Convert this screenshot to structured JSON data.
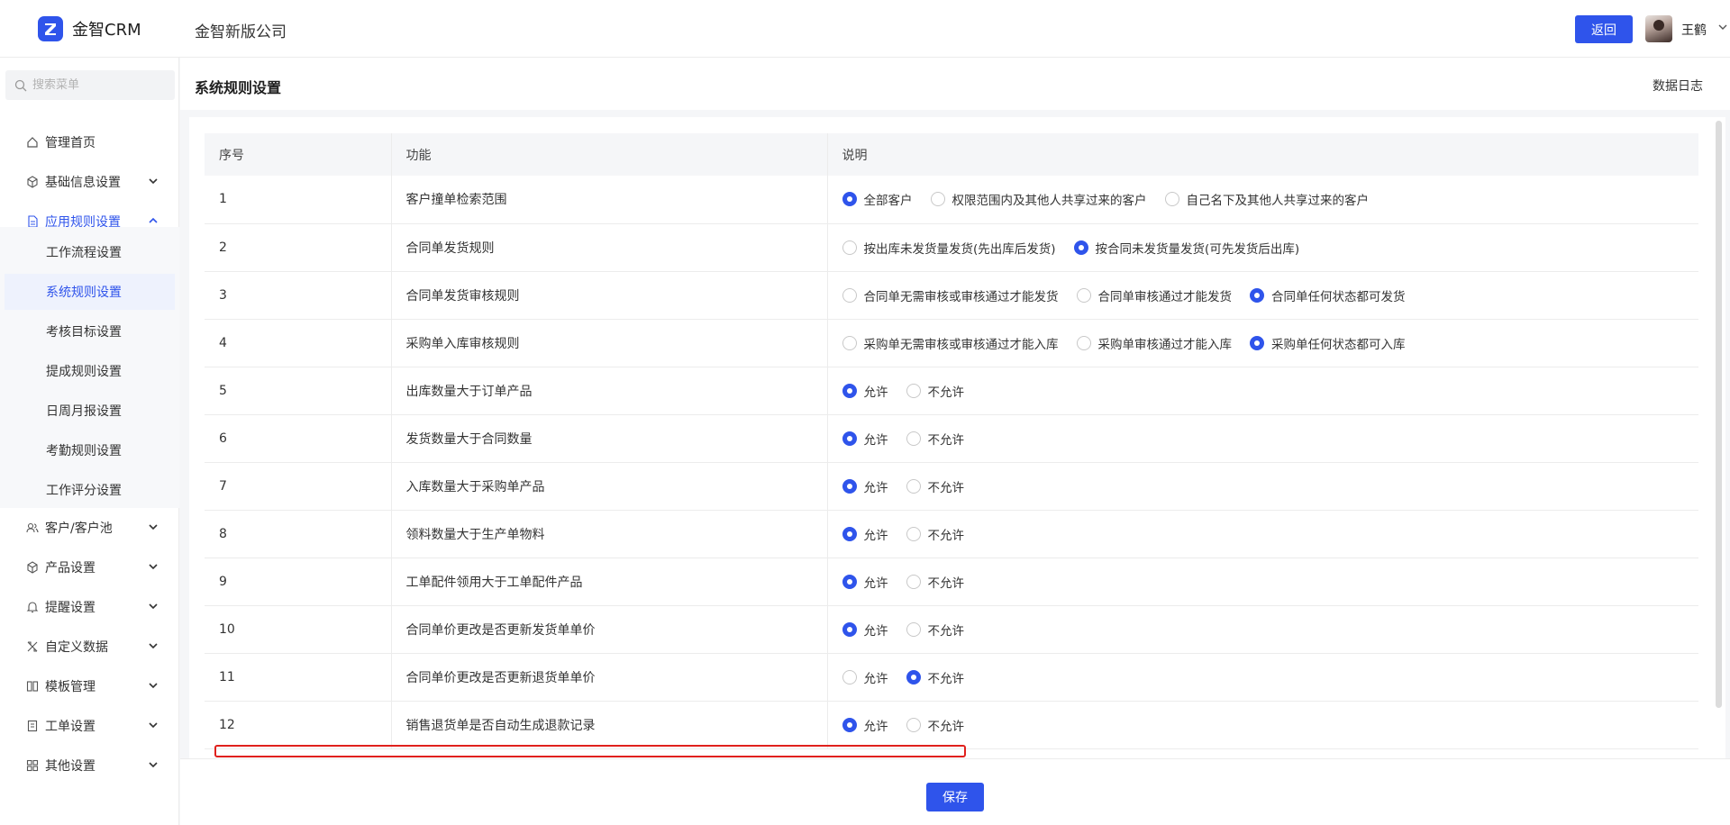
{
  "header": {
    "brand": "金智CRM",
    "company": "金智新版公司",
    "back_label": "返回",
    "user_name": "王鹤"
  },
  "sidebar": {
    "search_placeholder": "搜索菜单",
    "items": [
      {
        "label": "管理首页",
        "icon": "home-icon"
      },
      {
        "label": "基础信息设置",
        "icon": "cube-icon"
      },
      {
        "label": "应用规则设置",
        "icon": "document-icon"
      },
      {
        "label": "客户/客户池",
        "icon": "users-icon"
      },
      {
        "label": "产品设置",
        "icon": "box-icon"
      },
      {
        "label": "提醒设置",
        "icon": "bell-icon"
      },
      {
        "label": "自定义数据",
        "icon": "tools-icon"
      },
      {
        "label": "模板管理",
        "icon": "template-icon"
      },
      {
        "label": "工单设置",
        "icon": "workorder-icon"
      },
      {
        "label": "其他设置",
        "icon": "grid-icon"
      }
    ],
    "subitems": [
      "工作流程设置",
      "系统规则设置",
      "考核目标设置",
      "提成规则设置",
      "日周月报设置",
      "考勤规则设置",
      "工作评分设置"
    ]
  },
  "page": {
    "title": "系统规则设置",
    "data_log": "数据日志",
    "save_label": "保存"
  },
  "table": {
    "headers": [
      "序号",
      "功能",
      "说明"
    ],
    "rows": [
      {
        "no": "1",
        "feature": "客户撞单检索范围",
        "options": [
          "全部客户",
          "权限范围内及其他人共享过来的客户",
          "自己名下及其他人共享过来的客户"
        ],
        "selected": 0
      },
      {
        "no": "2",
        "feature": "合同单发货规则",
        "options": [
          "按出库未发货量发货(先出库后发货)",
          "按合同未发货量发货(可先发货后出库)"
        ],
        "selected": 1
      },
      {
        "no": "3",
        "feature": "合同单发货审核规则",
        "options": [
          "合同单无需审核或审核通过才能发货",
          "合同单审核通过才能发货",
          "合同单任何状态都可发货"
        ],
        "selected": 2
      },
      {
        "no": "4",
        "feature": "采购单入库审核规则",
        "options": [
          "采购单无需审核或审核通过才能入库",
          "采购单审核通过才能入库",
          "采购单任何状态都可入库"
        ],
        "selected": 2
      },
      {
        "no": "5",
        "feature": "出库数量大于订单产品",
        "options": [
          "允许",
          "不允许"
        ],
        "selected": 0
      },
      {
        "no": "6",
        "feature": "发货数量大于合同数量",
        "options": [
          "允许",
          "不允许"
        ],
        "selected": 0
      },
      {
        "no": "7",
        "feature": "入库数量大于采购单产品",
        "options": [
          "允许",
          "不允许"
        ],
        "selected": 0
      },
      {
        "no": "8",
        "feature": "领料数量大于生产单物料",
        "options": [
          "允许",
          "不允许"
        ],
        "selected": 0
      },
      {
        "no": "9",
        "feature": "工单配件领用大于工单配件产品",
        "options": [
          "允许",
          "不允许"
        ],
        "selected": 0
      },
      {
        "no": "10",
        "feature": "合同单价更改是否更新发货单单价",
        "options": [
          "允许",
          "不允许"
        ],
        "selected": 0
      },
      {
        "no": "11",
        "feature": "合同单价更改是否更新退货单单价",
        "options": [
          "允许",
          "不允许"
        ],
        "selected": 1
      },
      {
        "no": "12",
        "feature": "销售退货单是否自动生成退款记录",
        "options": [
          "允许",
          "不允许"
        ],
        "selected": 0
      }
    ]
  },
  "colors": {
    "accent": "#2f54eb",
    "highlight": "#e0201c"
  }
}
